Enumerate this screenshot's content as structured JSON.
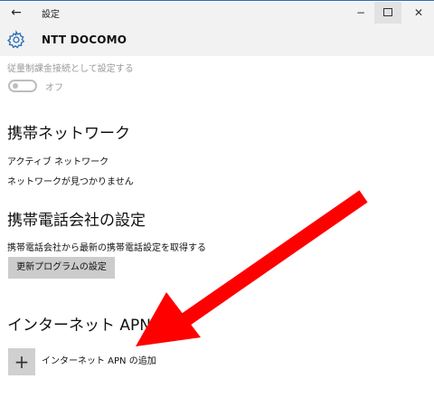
{
  "titlebar": {
    "back_glyph": "←",
    "title": "設定",
    "minimize_glyph": "−",
    "close_glyph": "✕"
  },
  "header": {
    "title": "NTT DOCOMO"
  },
  "metered": {
    "label": "従量制課金接続として設定する",
    "toggle_state": "オフ"
  },
  "mobile_network": {
    "heading": "携帯ネットワーク",
    "active_network_label": "アクティブ ネットワーク",
    "status": "ネットワークが見つかりません"
  },
  "carrier_settings": {
    "heading": "携帯電話会社の設定",
    "description": "携帯電話会社から最新の携帯電話設定を取得する",
    "update_button": "更新プログラムの設定"
  },
  "internet_apn": {
    "heading": "インターネット APN",
    "add_glyph": "+",
    "add_label": "インターネット APN の追加"
  },
  "annotation": {
    "arrow_color": "#ff0000"
  },
  "icons": {
    "back": "arrow-left-icon",
    "settings": "gear-icon",
    "minimize": "minimize-icon",
    "maximize": "maximize-icon",
    "close": "close-icon",
    "add": "plus-icon"
  }
}
